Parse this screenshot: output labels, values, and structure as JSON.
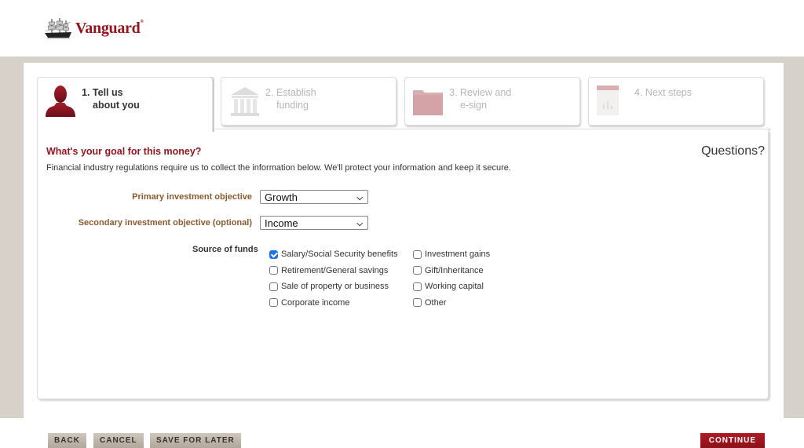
{
  "header": {
    "brand": "Vanguard",
    "brand_mark": "®",
    "brand_color": "#96151d"
  },
  "steps": [
    {
      "number": "1.",
      "line1": "Tell us",
      "line2": "about you",
      "icon": "person-icon",
      "active": true
    },
    {
      "number": "2.",
      "line1": "Establish",
      "line2": "funding",
      "icon": "bank-icon",
      "active": false
    },
    {
      "number": "3.",
      "line1": "Review and",
      "line2": "e-sign",
      "icon": "folder-icon",
      "active": false
    },
    {
      "number": "4.",
      "line1": "Next steps",
      "line2": "",
      "icon": "document-chart-icon",
      "active": false
    }
  ],
  "form": {
    "title": "What's your goal for this money?",
    "questions_link": "Questions?",
    "regulation_text": "Financial industry regulations require us to collect the information below. We'll protect your information and keep it secure.",
    "primary_objective": {
      "label": "Primary investment objective",
      "value": "Growth"
    },
    "secondary_objective": {
      "label": "Secondary investment objective (optional)",
      "value": "Income"
    },
    "source_of_funds": {
      "label": "Source of funds",
      "options": [
        {
          "label": "Salary/Social Security benefits",
          "checked": true
        },
        {
          "label": "Retirement/General savings",
          "checked": false
        },
        {
          "label": "Sale of property or business",
          "checked": false
        },
        {
          "label": "Corporate income",
          "checked": false
        },
        {
          "label": "Investment gains",
          "checked": false
        },
        {
          "label": "Gift/Inheritance",
          "checked": false
        },
        {
          "label": "Working capital",
          "checked": false
        },
        {
          "label": "Other",
          "checked": false
        }
      ]
    }
  },
  "buttons": {
    "back": "BACK",
    "cancel": "CANCEL",
    "save_for_later": "SAVE FOR LATER",
    "continue": "CONTINUE"
  }
}
